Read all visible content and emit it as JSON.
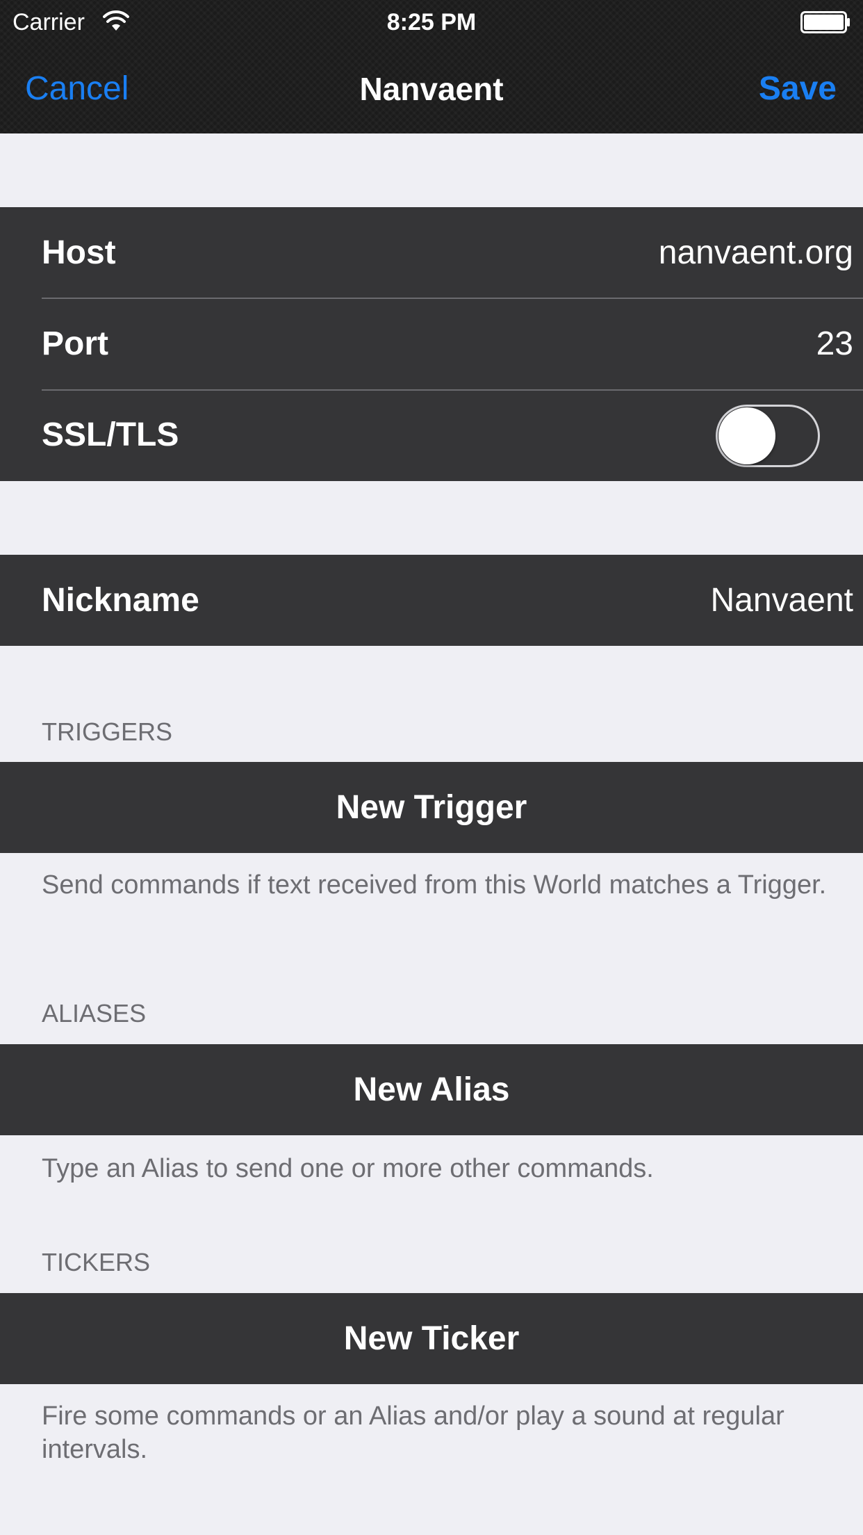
{
  "status_bar": {
    "carrier": "Carrier",
    "time": "8:25 PM",
    "wifi_icon": "wifi-icon",
    "battery_icon": "battery-icon"
  },
  "nav_bar": {
    "cancel_label": "Cancel",
    "title": "Nanvaent",
    "save_label": "Save",
    "accent_color": "#1a7ff2"
  },
  "connection": {
    "host_label": "Host",
    "host_value": "nanvaent.org",
    "port_label": "Port",
    "port_value": "23",
    "ssl_label": "SSL/TLS",
    "ssl_enabled": false
  },
  "identity": {
    "nickname_label": "Nickname",
    "nickname_value": "Nanvaent"
  },
  "triggers": {
    "header": "TRIGGERS",
    "button_label": "New Trigger",
    "footer": "Send commands if text received from this World matches a Trigger."
  },
  "aliases": {
    "header": "ALIASES",
    "button_label": "New Alias",
    "footer": "Type an Alias to send one or more other commands."
  },
  "tickers": {
    "header": "TICKERS",
    "button_label": "New Ticker",
    "footer": "Fire some commands or an Alias and/or play a sound at regular intervals."
  },
  "colors": {
    "cell_background": "#353537",
    "page_background": "#efeff4",
    "muted_text": "#6d6d72"
  }
}
